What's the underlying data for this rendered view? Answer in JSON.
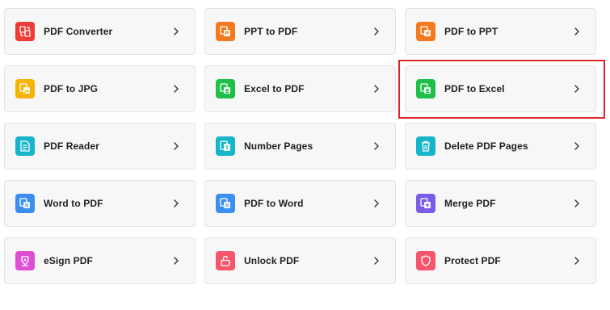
{
  "tools": [
    {
      "label": "PDF Converter",
      "icon": "pdf-converter-icon",
      "color": "#ee3b37"
    },
    {
      "label": "PPT to PDF",
      "icon": "ppt-to-pdf-icon",
      "color": "#f57a1f"
    },
    {
      "label": "PDF to PPT",
      "icon": "pdf-to-ppt-icon",
      "color": "#f57a1f"
    },
    {
      "label": "PDF to JPG",
      "icon": "pdf-to-jpg-icon",
      "color": "#f5b400"
    },
    {
      "label": "Excel to PDF",
      "icon": "excel-to-pdf-icon",
      "color": "#1fbf4a"
    },
    {
      "label": "PDF to Excel",
      "icon": "pdf-to-excel-icon",
      "color": "#1fbf4a"
    },
    {
      "label": "PDF Reader",
      "icon": "pdf-reader-icon",
      "color": "#17b5c9"
    },
    {
      "label": "Number Pages",
      "icon": "number-pages-icon",
      "color": "#17b5c9"
    },
    {
      "label": "Delete PDF Pages",
      "icon": "delete-pages-icon",
      "color": "#17b5c9"
    },
    {
      "label": "Word to PDF",
      "icon": "word-to-pdf-icon",
      "color": "#3b8ff0"
    },
    {
      "label": "PDF to Word",
      "icon": "pdf-to-word-icon",
      "color": "#3b8ff0"
    },
    {
      "label": "Merge PDF",
      "icon": "merge-pdf-icon",
      "color": "#7a5de8"
    },
    {
      "label": "eSign PDF",
      "icon": "esign-pdf-icon",
      "color": "#de4fd4"
    },
    {
      "label": "Unlock PDF",
      "icon": "unlock-pdf-icon",
      "color": "#f5566b"
    },
    {
      "label": "Protect PDF",
      "icon": "protect-pdf-icon",
      "color": "#f5566b"
    }
  ],
  "highlight": {
    "label": "PDF to Excel",
    "color": "#d9262b"
  },
  "chevron_icon": "chevron-right-icon"
}
